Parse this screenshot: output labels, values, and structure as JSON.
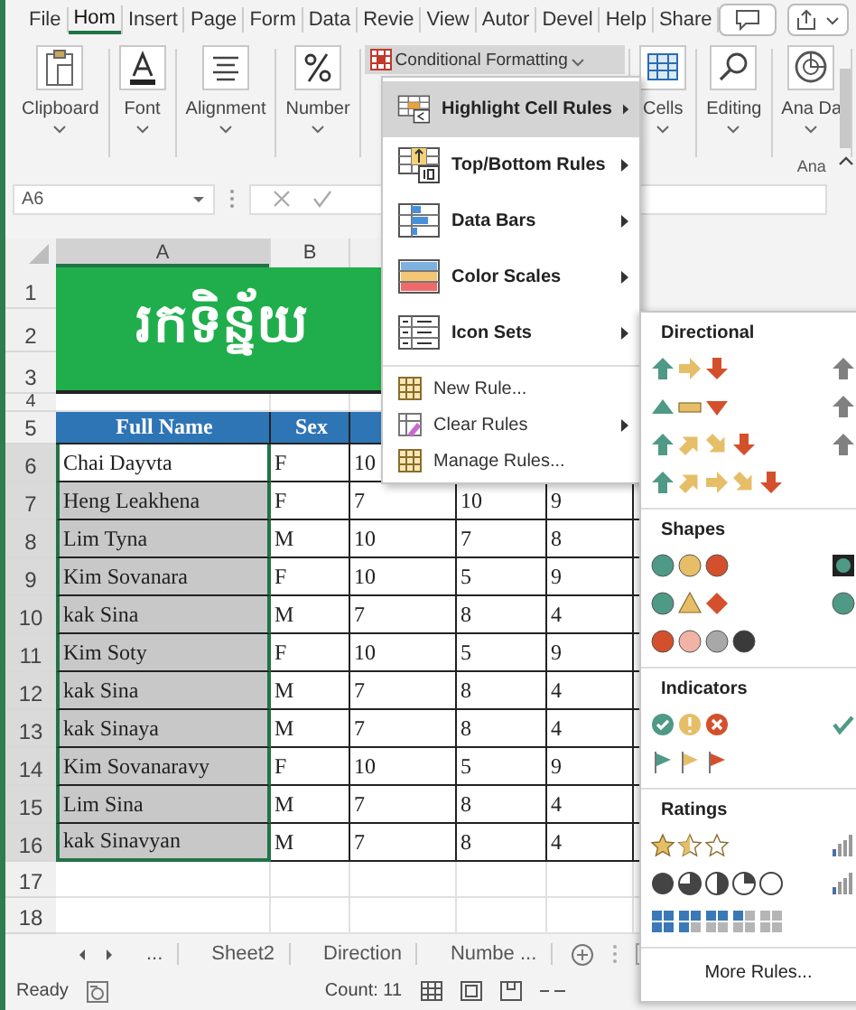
{
  "tabs": [
    {
      "label": "File",
      "selected": false
    },
    {
      "label": "Hom",
      "selected": true
    },
    {
      "label": "Insert",
      "selected": false
    },
    {
      "label": "Page",
      "selected": false
    },
    {
      "label": "Form",
      "selected": false
    },
    {
      "label": "Data",
      "selected": false
    },
    {
      "label": "Revie",
      "selected": false
    },
    {
      "label": "View",
      "selected": false
    },
    {
      "label": "Autor",
      "selected": false
    },
    {
      "label": "Devel",
      "selected": false
    },
    {
      "label": "Help",
      "selected": false
    },
    {
      "label": "Share",
      "selected": false
    }
  ],
  "ribbon": [
    {
      "kind": "group",
      "label": "Clipboard"
    },
    {
      "kind": "group",
      "label": "Font"
    },
    {
      "kind": "group",
      "label": "Alignment"
    },
    {
      "kind": "group",
      "label": "Number"
    },
    {
      "kind": "dropdown",
      "label": "Conditional Formatting",
      "selected": true
    },
    {
      "kind": "group",
      "label": "Cells"
    },
    {
      "kind": "group",
      "label": "Editing"
    },
    {
      "kind": "group",
      "label": "Ana Da",
      "footer": "Ana"
    }
  ],
  "name_box": "A6",
  "columns": [
    "A",
    "B"
  ],
  "title_rows": [
    "1",
    "2",
    "3"
  ],
  "title": "រកទិន្ន័យ",
  "spacer_row": "4",
  "header_row": {
    "number": "5",
    "cells": [
      "Full Name",
      "Sex"
    ]
  },
  "rows": [
    {
      "number": "6",
      "cells": [
        "Chai Dayvta",
        "F",
        "10"
      ],
      "selected": true,
      "active": true
    },
    {
      "number": "7",
      "cells": [
        "Heng Leakhena",
        "F",
        "7",
        "10",
        "9"
      ],
      "selected": true,
      "active": false
    },
    {
      "number": "8",
      "cells": [
        "Lim Tyna",
        "M",
        "10",
        "7",
        "8"
      ],
      "selected": true,
      "active": false
    },
    {
      "number": "9",
      "cells": [
        "Kim Sovanara",
        "F",
        "10",
        "5",
        "9"
      ],
      "selected": true,
      "active": false
    },
    {
      "number": "10",
      "cells": [
        "kak Sina",
        "M",
        "7",
        "8",
        "4"
      ],
      "selected": true,
      "active": false
    },
    {
      "number": "11",
      "cells": [
        "Kim Soty",
        "F",
        "10",
        "5",
        "9"
      ],
      "selected": true,
      "active": false
    },
    {
      "number": "12",
      "cells": [
        "kak Sina",
        "M",
        "7",
        "8",
        "4"
      ],
      "selected": true,
      "active": false
    },
    {
      "number": "13",
      "cells": [
        "kak Sinaya",
        "M",
        "7",
        "8",
        "4"
      ],
      "selected": true,
      "active": false
    },
    {
      "number": "14",
      "cells": [
        "Kim Sovanaravy",
        "F",
        "10",
        "5",
        "9"
      ],
      "selected": true,
      "active": false
    },
    {
      "number": "15",
      "cells": [
        "Lim Sina",
        "M",
        "7",
        "8",
        "4"
      ],
      "selected": true,
      "active": false
    },
    {
      "number": "16",
      "cells": [
        "kak Sinavyan",
        "M",
        "7",
        "8",
        "4"
      ],
      "selected": true,
      "active": false
    }
  ],
  "empty_rows": [
    "17",
    "18"
  ],
  "sheet_tabs": [
    "...",
    "Sheet2",
    "Direction",
    "Numbe ..."
  ],
  "status_bar": {
    "state": "Ready",
    "count": "Count: 11"
  },
  "menu": [
    {
      "kind": "highlight",
      "label": "Highlight Cell Rules",
      "submenu": true,
      "selected": true
    },
    {
      "kind": "topbottom",
      "label": "Top/Bottom Rules",
      "submenu": true,
      "selected": false
    },
    {
      "kind": "databars",
      "label": "Data Bars",
      "submenu": true,
      "selected": false
    },
    {
      "kind": "colorscales",
      "label": "Color Scales",
      "submenu": true,
      "selected": false
    },
    {
      "kind": "iconsets",
      "label": "Icon Sets",
      "submenu": true,
      "selected": false
    },
    {
      "kind": "new",
      "label": "New Rule...",
      "submenu": false,
      "selected": false
    },
    {
      "kind": "clear",
      "label": "Clear Rules",
      "submenu": true,
      "selected": false
    },
    {
      "kind": "manage",
      "label": "Manage Rules...",
      "submenu": false,
      "selected": false
    }
  ],
  "icon_sets": {
    "sections": [
      "Directional",
      "Shapes",
      "Indicators",
      "Ratings"
    ],
    "more": "More Rules..."
  }
}
